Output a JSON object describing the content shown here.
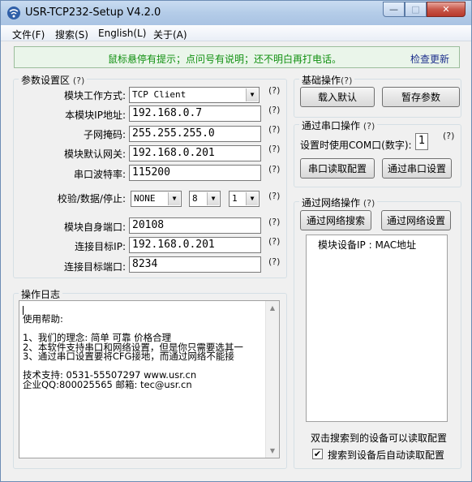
{
  "window": {
    "title": "USR-TCP232-Setup V4.2.0",
    "minimize_glyph": "—",
    "maximize_glyph": "□",
    "close_glyph": "✕"
  },
  "menu": [
    "文件(F)",
    "搜索(S)",
    "English(L)",
    "关于(A)"
  ],
  "hint": {
    "text": "鼠标悬停有提示；点问号有说明；还不明白再打电话。",
    "update_link": "检查更新"
  },
  "params": {
    "legend": "参数设置区",
    "help": "(?)",
    "rows": [
      {
        "label": "模块工作方式:",
        "value": "TCP Client"
      },
      {
        "label": "本模块IP地址:",
        "value": "192.168.0.7"
      },
      {
        "label": "子网掩码:",
        "value": "255.255.255.0"
      },
      {
        "label": "模块默认网关:",
        "value": "192.168.0.201"
      },
      {
        "label": "串口波特率:",
        "value": "115200"
      }
    ],
    "serial_format": {
      "label": "校验/数据/停止:",
      "parity": "NONE",
      "data_bits": "8",
      "stop_bits": "1"
    },
    "rows2": [
      {
        "label": "模块自身端口:",
        "value": "20108"
      },
      {
        "label": "连接目标IP:",
        "value": "192.168.0.201"
      },
      {
        "label": "连接目标端口:",
        "value": "8234"
      }
    ]
  },
  "basic_ops": {
    "legend": "基础操作",
    "help": "(?)",
    "load_default": "载入默认",
    "save_params": "暂存参数"
  },
  "serial_ops": {
    "legend": "通过串口操作",
    "help": "(?)",
    "com_label": "设置时使用COM口(数字):",
    "com_value": "1",
    "read_config": "串口读取配置",
    "set_via_serial": "通过串口设置"
  },
  "network_ops": {
    "legend": "通过网络操作",
    "help": "(?)",
    "search": "通过网络搜索",
    "set_via_network": "通过网络设置",
    "list_header": "模块设备IP   :   MAC地址",
    "dblclick_hint": "双击搜索到的设备可以读取配置",
    "auto_read_label": "搜索到设备后自动读取配置",
    "auto_read_checked": true
  },
  "log": {
    "legend": "操作日志",
    "lines": [
      "",
      "使用帮助:",
      "",
      "1、我们的理念: 简单 可靠 价格合理",
      "2、本软件支持串口和网络设置，但是你只需要选其一",
      "3、通过串口设置要将CFG接地，而通过网络不能接",
      "",
      "技术支持: 0531-55507297 www.usr.cn",
      "企业QQ:800025565 邮箱: tec@usr.cn"
    ]
  }
}
